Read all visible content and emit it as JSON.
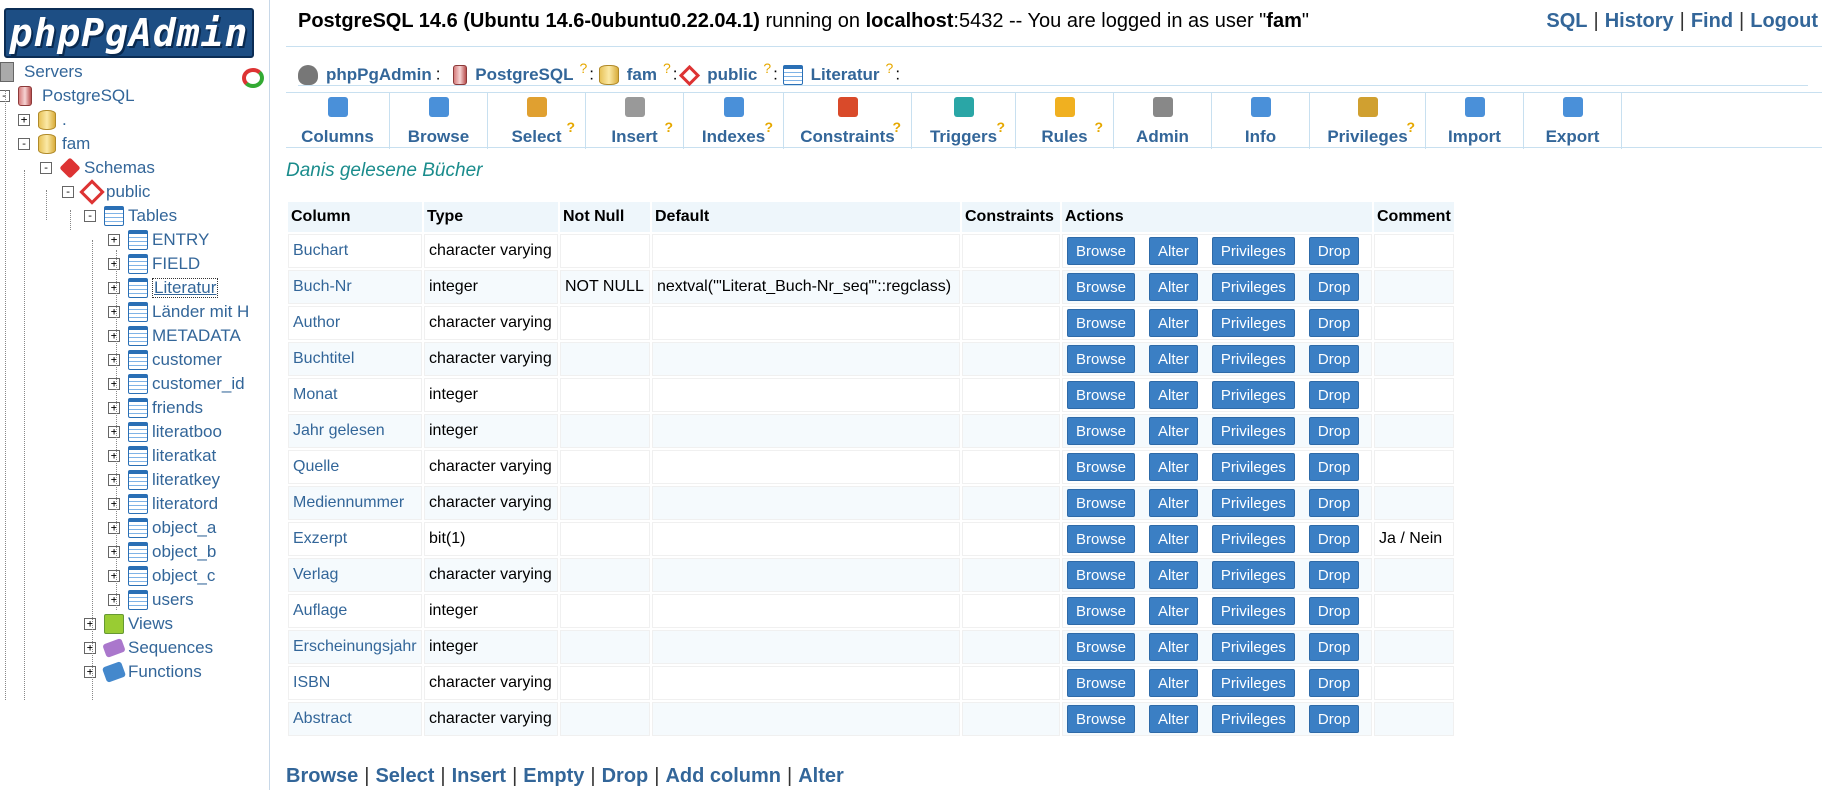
{
  "logo_text": "phpPgAdmin",
  "tree": {
    "servers": "Servers",
    "server": "PostgreSQL",
    "db_dot": ".",
    "db_fam": "fam",
    "schemas": "Schemas",
    "public": "public",
    "tables": "Tables",
    "table_list": [
      "ENTRY",
      "FIELD",
      "Literatur",
      "Länder mit H",
      "METADATA",
      "customer",
      "customer_id",
      "friends",
      "literatboo",
      "literatkat",
      "literatkey",
      "literatord",
      "object_a",
      "object_b",
      "object_c",
      "users"
    ],
    "views": "Views",
    "sequences": "Sequences",
    "functions": "Functions"
  },
  "topbar": {
    "product": "PostgreSQL 14.6 (Ubuntu 14.6-0ubuntu0.22.04.1)",
    "running_on": " running on ",
    "host": "localhost",
    "port_text": ":5432 -- You are logged in as user \"",
    "user": "fam",
    "quote_end": "\"",
    "links": [
      "SQL",
      "History",
      "Find",
      "Logout"
    ]
  },
  "trail": {
    "app": "phpPgAdmin",
    "server": "PostgreSQL",
    "database": "fam",
    "schema": "public",
    "table": "Literatur",
    "help_mark": "?",
    "sep": ":"
  },
  "tabs": [
    {
      "label": "Columns",
      "help": false,
      "color": "#4a90d9"
    },
    {
      "label": "Browse",
      "help": false,
      "color": "#4a90d9"
    },
    {
      "label": "Select",
      "help": true,
      "color": "#e0a030"
    },
    {
      "label": "Insert",
      "help": true,
      "color": "#999999"
    },
    {
      "label": "Indexes",
      "help": true,
      "color": "#4a90d9"
    },
    {
      "label": "Constraints",
      "help": true,
      "color": "#d94a2a"
    },
    {
      "label": "Triggers",
      "help": true,
      "color": "#2aa6a6"
    },
    {
      "label": "Rules",
      "help": true,
      "color": "#f0b020"
    },
    {
      "label": "Admin",
      "help": false,
      "color": "#888888"
    },
    {
      "label": "Info",
      "help": false,
      "color": "#4a90d9"
    },
    {
      "label": "Privileges",
      "help": true,
      "color": "#d0a030"
    },
    {
      "label": "Import",
      "help": false,
      "color": "#4a90d9"
    },
    {
      "label": "Export",
      "help": false,
      "color": "#4a90d9"
    }
  ],
  "caption": "Danis gelesene Bücher",
  "table_headers": [
    "Column",
    "Type",
    "Not Null",
    "Default",
    "Constraints",
    "Actions",
    "Comment"
  ],
  "action_labels": [
    "Browse",
    "Alter",
    "Privileges",
    "Drop"
  ],
  "columns": [
    {
      "name": "Buchart",
      "type": "character varying",
      "notnull": "",
      "default": "",
      "constraints": "",
      "comment": ""
    },
    {
      "name": "Buch-Nr",
      "type": "integer",
      "notnull": "NOT NULL",
      "default": "nextval('\"Literat_Buch-Nr_seq\"'::regclass)",
      "constraints": "",
      "comment": ""
    },
    {
      "name": "Author",
      "type": "character varying",
      "notnull": "",
      "default": "",
      "constraints": "",
      "comment": ""
    },
    {
      "name": "Buchtitel",
      "type": "character varying",
      "notnull": "",
      "default": "",
      "constraints": "",
      "comment": ""
    },
    {
      "name": "Monat",
      "type": "integer",
      "notnull": "",
      "default": "",
      "constraints": "",
      "comment": ""
    },
    {
      "name": "Jahr gelesen",
      "type": "integer",
      "notnull": "",
      "default": "",
      "constraints": "",
      "comment": ""
    },
    {
      "name": "Quelle",
      "type": "character varying",
      "notnull": "",
      "default": "",
      "constraints": "",
      "comment": ""
    },
    {
      "name": "Mediennummer",
      "type": "character varying",
      "notnull": "",
      "default": "",
      "constraints": "",
      "comment": ""
    },
    {
      "name": "Exzerpt",
      "type": "bit(1)",
      "notnull": "",
      "default": "",
      "constraints": "",
      "comment": "Ja / Nein"
    },
    {
      "name": "Verlag",
      "type": "character varying",
      "notnull": "",
      "default": "",
      "constraints": "",
      "comment": ""
    },
    {
      "name": "Auflage",
      "type": "integer",
      "notnull": "",
      "default": "",
      "constraints": "",
      "comment": ""
    },
    {
      "name": "Erscheinungsjahr",
      "type": "integer",
      "notnull": "",
      "default": "",
      "constraints": "",
      "comment": ""
    },
    {
      "name": "ISBN",
      "type": "character varying",
      "notnull": "",
      "default": "",
      "constraints": "",
      "comment": ""
    },
    {
      "name": "Abstract",
      "type": "character varying",
      "notnull": "",
      "default": "",
      "constraints": "",
      "comment": ""
    }
  ],
  "bottom_links": [
    "Browse",
    "Select",
    "Insert",
    "Empty",
    "Drop",
    "Add column",
    "Alter"
  ]
}
